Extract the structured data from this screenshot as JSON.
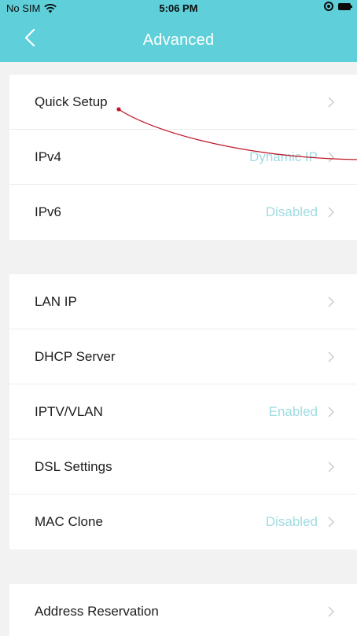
{
  "status_bar": {
    "carrier": "No SIM",
    "time": "5:06 PM",
    "icons": [
      "wifi-icon",
      "orientation-lock-icon",
      "battery-icon"
    ]
  },
  "nav": {
    "title": "Advanced",
    "back_icon": "chevron-left-icon"
  },
  "groups": [
    {
      "rows": [
        {
          "label": "Quick Setup",
          "value": ""
        },
        {
          "label": "IPv4",
          "value": "Dynamic IP"
        },
        {
          "label": "IPv6",
          "value": "Disabled"
        }
      ]
    },
    {
      "rows": [
        {
          "label": "LAN IP",
          "value": ""
        },
        {
          "label": "DHCP Server",
          "value": ""
        },
        {
          "label": "IPTV/VLAN",
          "value": "Enabled"
        },
        {
          "label": "DSL Settings",
          "value": ""
        },
        {
          "label": "MAC Clone",
          "value": "Disabled"
        }
      ]
    },
    {
      "rows": [
        {
          "label": "Address Reservation",
          "value": ""
        }
      ]
    }
  ],
  "colors": {
    "header": "#5fd0d9",
    "value_text": "#9fdce1",
    "annotation": "#c0182a"
  }
}
